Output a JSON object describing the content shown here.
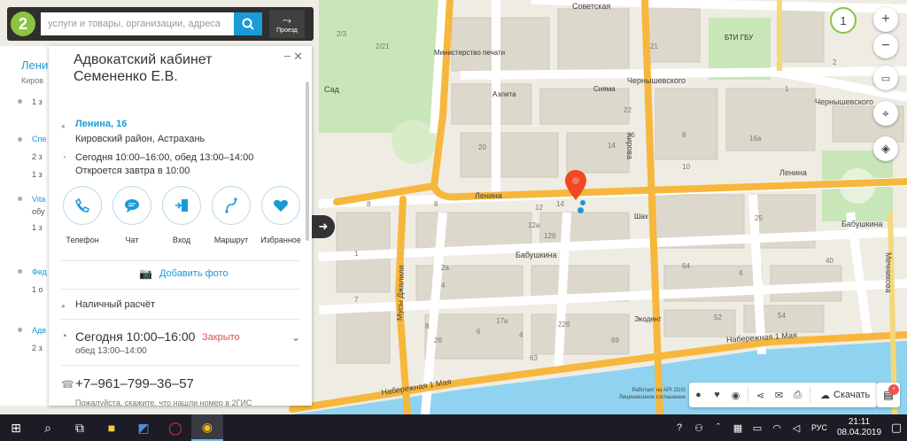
{
  "search": {
    "placeholder": "услуги и товары, организации, адреса",
    "route_label": "Проезд",
    "logo": "2"
  },
  "left_list": {
    "title": "Лени",
    "subtitle": "Киров",
    "items": [
      {
        "label": "Спе",
        "meta": "2 з"
      },
      {
        "label": "Vita",
        "meta": "обу"
      },
      {
        "label": "Фед",
        "meta": "1 о"
      },
      {
        "label": "Адв",
        "meta": "2 з"
      }
    ],
    "extra_meta": [
      "1 з",
      "1 з",
      "1 з"
    ]
  },
  "card": {
    "title": "Адвокатский кабинет Семененко Е.В.",
    "address_street": "Ленина, 16",
    "address_district": "Кировский район, Астрахань",
    "hours_line": "Сегодня 10:00–16:00, обед 13:00–14:00",
    "hours_next": "Откроется завтра в 10:00",
    "actions": [
      {
        "label": "Телефон",
        "icon": "phone-icon"
      },
      {
        "label": "Чат",
        "icon": "chat-icon"
      },
      {
        "label": "Вход",
        "icon": "entrance-icon"
      },
      {
        "label": "Маршрут",
        "icon": "route-icon"
      },
      {
        "label": "Избранное",
        "icon": "heart-icon"
      }
    ],
    "add_photo": "Добавить фото",
    "payment": "Наличный расчёт",
    "today_label": "Сегодня 10:00–16:00",
    "today_status": "Закрыто",
    "today_lunch": "обед 13:00–14:00",
    "phone": "+7‒961‒799‒36‒57",
    "bottom_text": "Пожалуйста, скажите, что нашли номер в 2ГИС"
  },
  "map": {
    "zoom_level": "1",
    "streets": {
      "sovetskaya": "Советская",
      "chernyshevskogo1": "Чернышевского",
      "chernyshevskogo2": "Чернышевского",
      "kirova": "Кирова",
      "lenina1": "Ленина",
      "lenina2": "Ленина",
      "babushkina1": "Бабушкина",
      "babushkina2": "Бабушкина",
      "musy": "Мусы Джалиля",
      "naberezhnaya1": "Набережная 1 Мая",
      "naberezhnaya2": "Набережная 1 Мая",
      "mechnikova": "Мечникова",
      "sad": "Сад"
    },
    "pois": {
      "ministry": "Министерство печати",
      "aelita": "Аэлита",
      "siyama": "Сияма",
      "bti": "БТИ ГБУ",
      "shah": "Шах",
      "ekodent": "Экодент"
    },
    "house_numbers": [
      "2/3",
      "2/21",
      "8",
      "14",
      "12",
      "12а",
      "12б",
      "8",
      "1",
      "2а",
      "4",
      "7",
      "8",
      "26",
      "17а",
      "4",
      "6",
      "22б",
      "63",
      "69",
      "8",
      "10",
      "14",
      "16",
      "20",
      "21",
      "22",
      "2",
      "1",
      "16а",
      "4",
      "25",
      "40",
      "64",
      "54",
      "52"
    ],
    "footer_line1": "Работает на API 2GIS",
    "footer_line2": "Лицензионное соглашение"
  },
  "toolbar": {
    "download_label": "Скачать"
  },
  "taskbar": {
    "lang": "РУС",
    "time": "21:11",
    "date": "08.04.2019"
  },
  "colors": {
    "accent": "#199bd8",
    "logo_green": "#8bc53f",
    "road": "#f6b73c",
    "closed": "#d9534f",
    "water": "#8fd3f0"
  }
}
